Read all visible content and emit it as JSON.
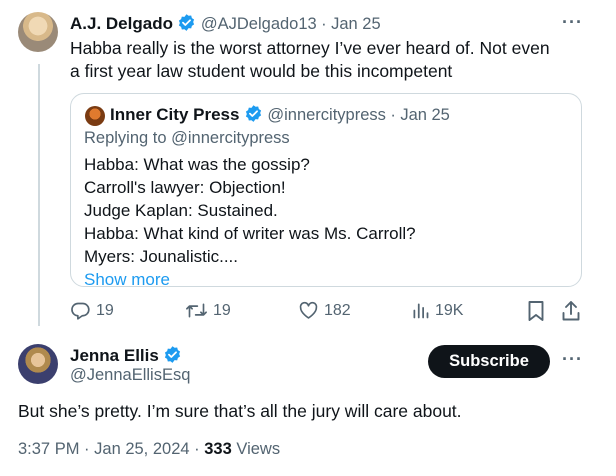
{
  "original_tweet": {
    "author_name": "A.J. Delgado",
    "handle": "@AJDelgado13",
    "date": "Jan 25",
    "text_line1": "Habba really is the worst attorney I’ve ever heard of. Not even",
    "text_line2": "a first year law student would be this incompetent",
    "more_label": "···",
    "quoted_tweet": {
      "author_name": "Inner City Press",
      "handle": "@innercitypress",
      "date": "Jan 25",
      "replying_to_prefix": "Replying to ",
      "replying_to_handle": "@innercitypress",
      "lines": [
        "Habba: What was the gossip?",
        "Carroll's lawyer: Objection!",
        "Judge Kaplan: Sustained.",
        "Habba: What kind of writer was Ms. Carroll?",
        "Myers: Jounalistic...."
      ],
      "show_more_label": "Show more"
    },
    "actions": {
      "replies": "19",
      "reposts": "19",
      "likes": "182",
      "views": "19K"
    }
  },
  "reply_tweet": {
    "author_name": "Jenna Ellis",
    "handle": "@JennaEllisEsq",
    "subscribe_label": "Subscribe",
    "more_label": "···",
    "text": "But she’s pretty. I’m sure that’s all the jury will care about.",
    "time": "3:37 PM",
    "date": "Jan 25, 2024",
    "views_count": "333",
    "views_label": "Views"
  },
  "colors": {
    "verified_blue": "#1d9bf0",
    "secondary_text": "#536471",
    "border": "#cfd9de"
  }
}
